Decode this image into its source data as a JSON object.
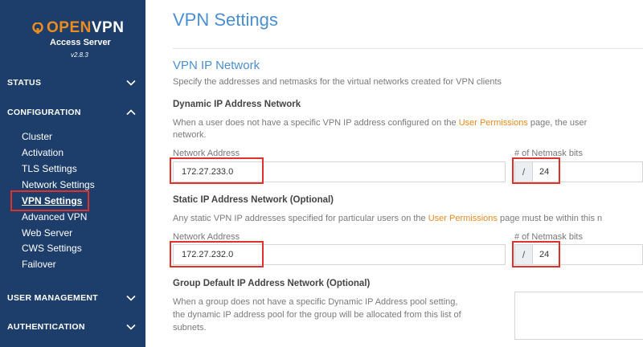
{
  "sidebar": {
    "logo_open": "OPEN",
    "logo_vpn": "VPN",
    "logo_sub": "Access Server",
    "version": "v2.8.3",
    "sections": {
      "status": "STATUS",
      "configuration": "CONFIGURATION",
      "user_management": "USER MANAGEMENT",
      "authentication": "AUTHENTICATION"
    },
    "items": [
      "Cluster",
      "Activation",
      "TLS Settings",
      "Network Settings",
      "VPN Settings",
      "Advanced VPN",
      "Web Server",
      "CWS Settings",
      "Failover"
    ],
    "active_item": "VPN Settings"
  },
  "main": {
    "title": "VPN Settings",
    "section_title": "VPN IP Network",
    "section_desc": "Specify the addresses and netmasks for the virtual networks created for VPN clients",
    "dynamic": {
      "heading": "Dynamic IP Address Network",
      "desc_before": "When a user does not have a specific VPN IP address configured on the ",
      "desc_link": "User Permissions",
      "desc_after": " page, the user",
      "desc_line2": "network.",
      "network_label": "Network Address",
      "network_value": "172.27.233.0",
      "netmask_label": "# of Netmask bits",
      "netmask_prefix": "/",
      "netmask_value": "24"
    },
    "static": {
      "heading": "Static IP Address Network (Optional)",
      "desc_before": "Any static VPN IP addresses specified for particular users on the ",
      "desc_link": "User Permissions",
      "desc_after": " page must be within this n",
      "network_label": "Network Address",
      "network_value": "172.27.232.0",
      "netmask_label": "# of Netmask bits",
      "netmask_prefix": "/",
      "netmask_value": "24"
    },
    "group": {
      "heading": "Group Default IP Address Network (Optional)",
      "desc_line1": "When a group does not have a specific Dynamic IP Address pool setting,",
      "desc_line2": "the dynamic IP address pool for the group will be allocated from this list of",
      "desc_line3": "subnets."
    }
  },
  "colors": {
    "sidebar_bg": "#1d3e6a",
    "accent_blue": "#4a8fcf",
    "link_orange": "#e98b20",
    "highlight_red": "#e0312a"
  }
}
